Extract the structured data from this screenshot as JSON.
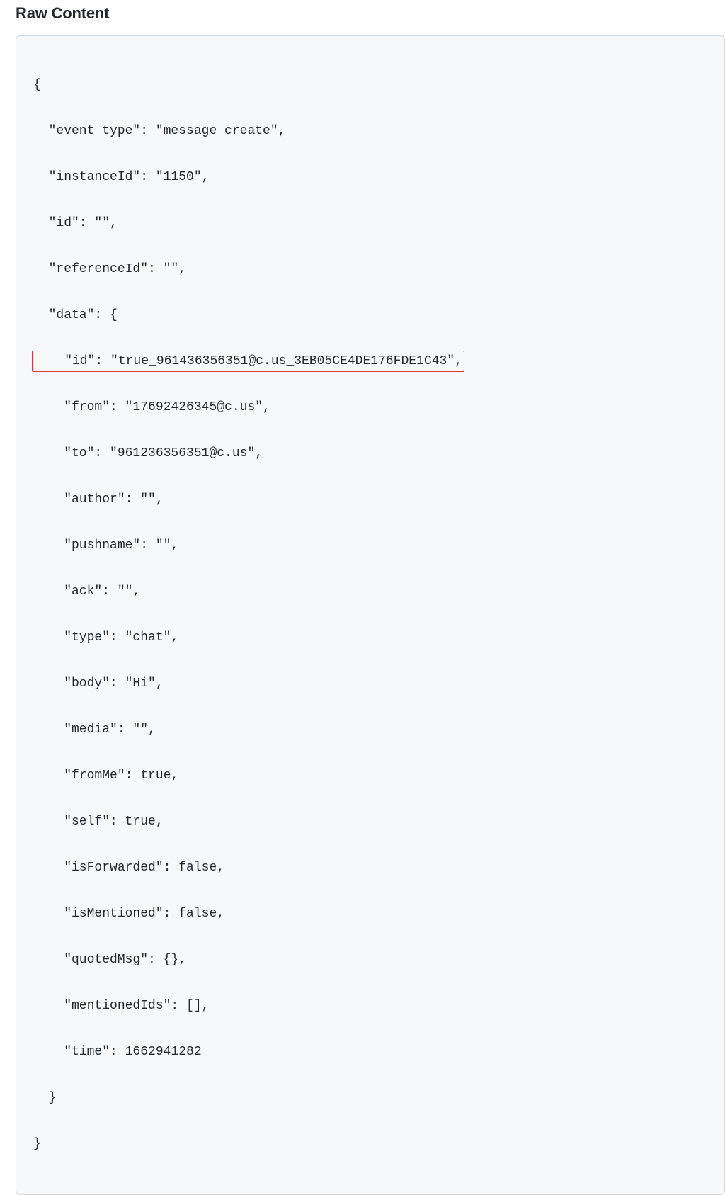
{
  "title": "Raw Content",
  "code": {
    "l0": "{",
    "l1": "  \"event_type\": \"message_create\",",
    "l2": "  \"instanceId\": \"1150\",",
    "l3": "  \"id\": \"\",",
    "l4": "  \"referenceId\": \"\",",
    "l5": "  \"data\": {",
    "l6_highlight": "    \"id\": \"true_961436356351@c.us_3EB05CE4DE176FDE1C43\",",
    "l7": "    \"from\": \"17692426345@c.us\",",
    "l8": "    \"to\": \"961236356351@c.us\",",
    "l9": "    \"author\": \"\",",
    "l10": "    \"pushname\": \"\",",
    "l11": "    \"ack\": \"\",",
    "l12": "    \"type\": \"chat\",",
    "l13": "    \"body\": \"Hi\",",
    "l14": "    \"media\": \"\",",
    "l15": "    \"fromMe\": true,",
    "l16": "    \"self\": true,",
    "l17": "    \"isForwarded\": false,",
    "l18": "    \"isMentioned\": false,",
    "l19": "    \"quotedMsg\": {},",
    "l20": "    \"mentionedIds\": [],",
    "l21": "    \"time\": 1662941282",
    "l22": "  }",
    "l23": "}"
  }
}
